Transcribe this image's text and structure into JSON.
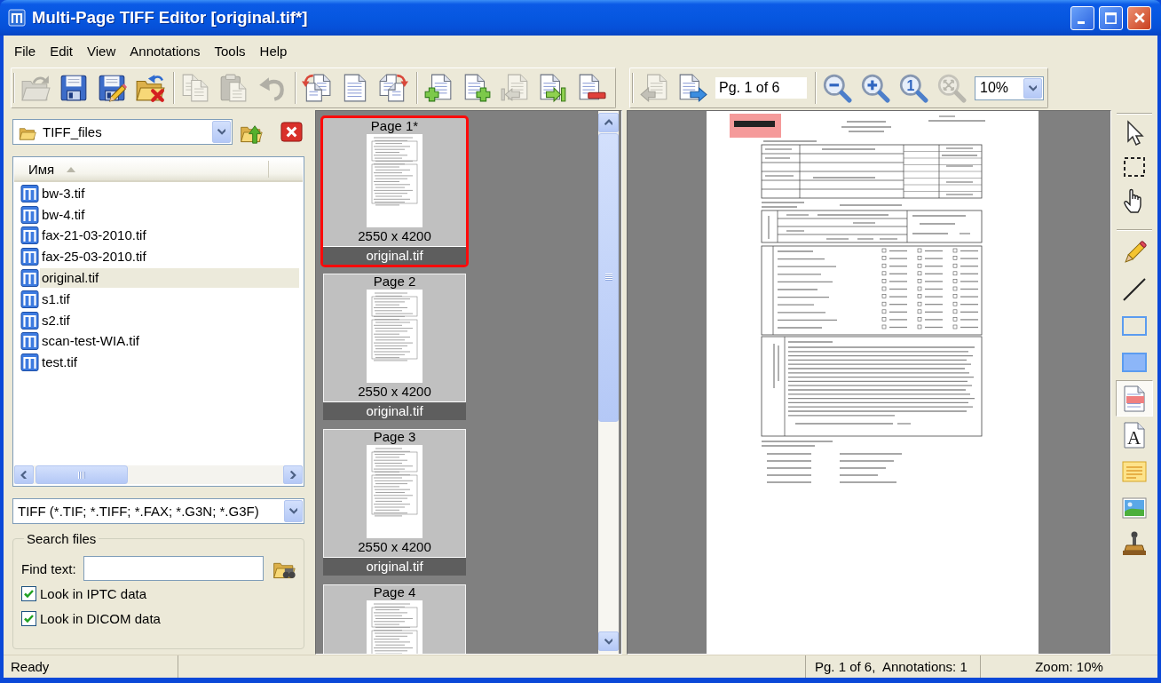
{
  "window": {
    "title": "Multi-Page TIFF Editor [original.tif*]"
  },
  "menu": [
    "File",
    "Edit",
    "View",
    "Annotations",
    "Tools",
    "Help"
  ],
  "toolbar": [
    [
      {
        "kind": "open",
        "disabled": true
      },
      {
        "kind": "save",
        "disabled": false
      },
      {
        "kind": "save_as",
        "disabled": false
      },
      {
        "kind": "close",
        "disabled": false
      }
    ],
    [
      {
        "kind": "copy",
        "disabled": true
      },
      {
        "kind": "paste",
        "disabled": true
      },
      {
        "kind": "undo",
        "disabled": true
      }
    ],
    [
      {
        "kind": "rotate_left",
        "disabled": false
      },
      {
        "kind": "page",
        "disabled": false
      },
      {
        "kind": "rotate_right",
        "disabled": false
      }
    ],
    [
      {
        "kind": "insert",
        "disabled": false
      },
      {
        "kind": "append",
        "disabled": false
      },
      {
        "kind": "move",
        "disabled": true
      },
      {
        "kind": "extract",
        "disabled": false
      },
      {
        "kind": "delete",
        "disabled": false
      }
    ]
  ],
  "navigation": {
    "buttons": [
      {
        "kind": "previous",
        "disabled": true
      },
      {
        "kind": "next",
        "disabled": false
      }
    ],
    "page_field": "Pg. 1 of 6",
    "zoom_buttons": [
      {
        "kind": "zoom_out",
        "disabled": false
      },
      {
        "kind": "zoom_in",
        "disabled": false
      },
      {
        "kind": "actual_size",
        "glyph": "1",
        "disabled": false
      },
      {
        "kind": "fit",
        "disabled": true
      }
    ],
    "zoom": "10%"
  },
  "folder": {
    "value": "TIFF_files"
  },
  "file_list": {
    "column": "Имя",
    "items": [
      {
        "name": "bw-3.tif",
        "selected": false
      },
      {
        "name": "bw-4.tif",
        "selected": false
      },
      {
        "name": "fax-21-03-2010.tif",
        "selected": false
      },
      {
        "name": "fax-25-03-2010.tif",
        "selected": false
      },
      {
        "name": "original.tif",
        "selected": true
      },
      {
        "name": "s1.tif",
        "selected": false
      },
      {
        "name": "s2.tif",
        "selected": false
      },
      {
        "name": "scan-test-WIA.tif",
        "selected": false
      },
      {
        "name": "test.tif",
        "selected": false
      }
    ]
  },
  "filter": {
    "value": "TIFF (*.TIF; *.TIFF; *.FAX; *.G3N; *.G3F)"
  },
  "search": {
    "title": "Search files",
    "label": "Find text:",
    "options": [
      {
        "label": "Look in IPTC data",
        "checked": true
      },
      {
        "label": "Look in DICOM data",
        "checked": true
      }
    ]
  },
  "thumbnails": [
    {
      "title": "Page 1*",
      "size": "2550 x 4200",
      "file": "original.tif",
      "selected": true
    },
    {
      "title": "Page 2",
      "size": "2550 x 4200",
      "file": "original.tif",
      "selected": false
    },
    {
      "title": "Page 3",
      "size": "2550 x 4200",
      "file": "original.tif",
      "selected": false
    },
    {
      "title": "Page 4",
      "selected": false
    }
  ],
  "tools": [
    [
      {
        "kind": "pointer",
        "selected": false
      },
      {
        "kind": "select_area",
        "selected": false
      },
      {
        "kind": "hand",
        "selected": false
      }
    ],
    [
      {
        "kind": "pencil",
        "selected": false
      },
      {
        "kind": "line",
        "selected": false
      },
      {
        "kind": "rectangle",
        "selected": false
      },
      {
        "kind": "filled_rectangle",
        "selected": false
      },
      {
        "kind": "highlight",
        "selected": true
      },
      {
        "kind": "text",
        "glyph": "A",
        "selected": false
      },
      {
        "kind": "note",
        "selected": false
      },
      {
        "kind": "image",
        "selected": false
      },
      {
        "kind": "stamp",
        "selected": false
      }
    ]
  ],
  "status_bar": {
    "message": "Ready",
    "page_info": "Pg. 1 of 6,  Annotations: 1",
    "zoom": "Zoom: 10%"
  }
}
